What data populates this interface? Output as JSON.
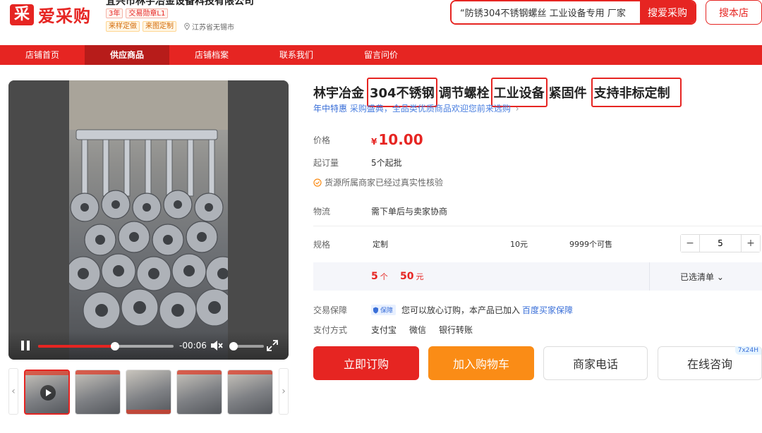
{
  "colors": {
    "brand": "#e62522",
    "link": "#3a6fd8",
    "cart": "#fa8c16"
  },
  "header": {
    "logo_mark": "采",
    "logo_text": "爱采购",
    "shop_name": "宜兴市林宇冶金设备科技有限公司",
    "badge_year": "3年",
    "badge_medal": "交易勋章L1",
    "tag_sample": "来样定做",
    "tag_drawing": "来图定制",
    "location": "江苏省无锡市",
    "search_value": "“防锈304不锈钢螺丝 工业设备专用 厂家",
    "search_button": "搜爱采购",
    "store_button": "搜本店"
  },
  "nav": {
    "items": [
      "店铺首页",
      "供应商品",
      "店铺档案",
      "联系我们",
      "留言问价"
    ],
    "active_index": 1
  },
  "video": {
    "time": "-00:06",
    "progress": 0.57,
    "volume": 0.1
  },
  "product": {
    "title_pre": "林宇冶金",
    "title_hl1": "304不锈钢",
    "title_mid1": "调节螺栓",
    "title_hl2": "工业设备",
    "title_mid2": "紧固件",
    "title_hl3": "支持非标定制",
    "promo_tag": "年中特惠",
    "promo_text": "采购盛典，全品类优质商品欢迎您前来选购",
    "promo_more": "›",
    "price_label": "价格",
    "price_currency": "¥",
    "price_value": "10.00",
    "moq_label": "起订量",
    "moq_value": "5个起批",
    "verify_text": "货源所属商家已经过真实性核验",
    "logistics_label": "物流",
    "logistics_value": "需下单后与卖家协商",
    "spec_label": "规格",
    "spec_name": "定制",
    "spec_price": "10元",
    "spec_stock": "9999个可售",
    "quantity": "5",
    "qty_minus": "−",
    "qty_plus": "+",
    "summary_qty": "5",
    "summary_qty_unit": "个",
    "summary_total": "50",
    "summary_total_unit": "元",
    "selected_list": "已选清单 ⌄",
    "guarantee_label": "交易保障",
    "guarantee_badge": "保障",
    "guarantee_text": "您可以放心订购，本产品已加入",
    "guarantee_link": "百度买家保障",
    "pay_label": "支付方式",
    "pay_methods": [
      "支付宝",
      "微信",
      "银行转账"
    ],
    "btn_buy": "立即订购",
    "btn_cart": "加入购物车",
    "btn_phone": "商家电话",
    "btn_chat": "在线咨询",
    "chat_badge": "7x24H"
  }
}
